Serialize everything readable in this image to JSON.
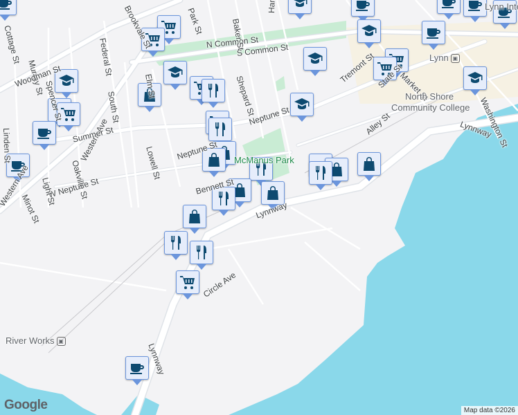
{
  "streets": {
    "n_common": "N Common St",
    "s_common": "S Common St",
    "federal": "Federal St",
    "western_ave": "Western Ave",
    "western_ave2": "Western Ave",
    "summer": "Summer St",
    "neptune": "Neptune St",
    "neptune2": "Neptune St",
    "w_neptune": "W Neptune St",
    "lowell": "Lowell St",
    "oakville": "Oakville St",
    "south": "South St",
    "spencer": "Spencer St",
    "murray": "Murray St",
    "light": "Light St",
    "minot": "Minot St",
    "linden": "Linden St",
    "elm": "Elm St",
    "shepard": "Shepard St",
    "baker": "Baker St",
    "hanover": "Hanover St",
    "park": "Park St",
    "tremont": "Tremont St",
    "market": "Market St",
    "state": "State St",
    "washington": "Washington St",
    "alley": "Alley St",
    "lynnway": "Lynnway",
    "lynnway2": "Lynnway",
    "lynnway3": "Lynnway",
    "circle": "Circle Ave",
    "bennett": "Bennett St",
    "brookvale": "Brookvale St",
    "woodman": "Woodman St",
    "summer2": "Summer St",
    "cottage": "Cottage St"
  },
  "places": {
    "park": "McManus Park",
    "college_line1": "North Shore",
    "college_line2": "Community College",
    "lynn_station": "Lynn",
    "river_works": "River Works",
    "lynn_intl": "Lynn Intern"
  },
  "markers": [
    "coffee",
    "education",
    "coffee",
    "coffee",
    "coffee",
    "coffee",
    "cart",
    "cart",
    "education",
    "coffee",
    "education",
    "cart",
    "cart",
    "education",
    "education",
    "education",
    "cart",
    "restaurant",
    "shopping",
    "education",
    "cart",
    "cart",
    "cart",
    "restaurant",
    "coffee",
    "shopping",
    "shopping",
    "coffee",
    "restaurant",
    "coffee",
    "shopping",
    "shopping",
    "restaurant",
    "shopping",
    "restaurant",
    "shopping",
    "shopping",
    "restaurant",
    "restaurant",
    "cart",
    "coffee"
  ],
  "colors": {
    "water": "#8ad8ea",
    "park": "#c9ecd4",
    "road": "#ffffff",
    "marker_bg": "#e6edfb",
    "marker_icon": "#0d4a70"
  },
  "footer": {
    "logo": "Google",
    "attribution": "Map data ©2026"
  }
}
